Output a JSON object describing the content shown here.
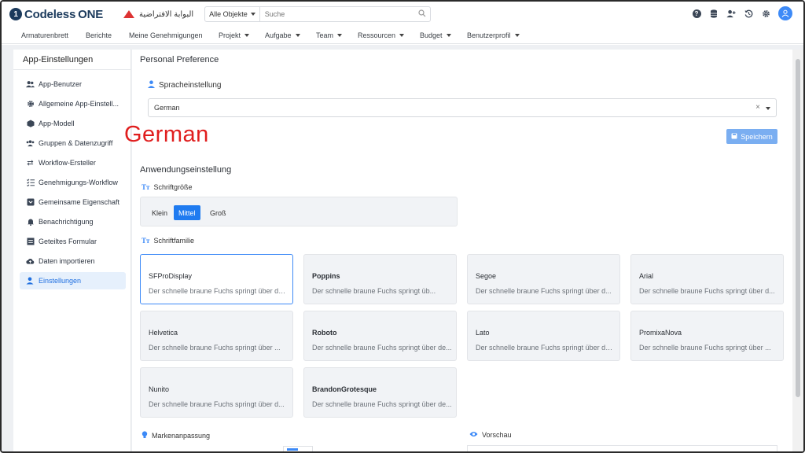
{
  "header": {
    "logo_text": "Codeless",
    "logo_one": "ONE",
    "arabic_portal": "البوابة الافتراضية",
    "search_scope": "Alle Objekte",
    "search_placeholder": "Suche"
  },
  "menu": [
    {
      "label": "Armaturenbrett",
      "has_caret": false
    },
    {
      "label": "Berichte",
      "has_caret": false
    },
    {
      "label": "Meine Genehmigungen",
      "has_caret": false
    },
    {
      "label": "Projekt",
      "has_caret": true
    },
    {
      "label": "Aufgabe",
      "has_caret": true
    },
    {
      "label": "Team",
      "has_caret": true
    },
    {
      "label": "Ressourcen",
      "has_caret": true
    },
    {
      "label": "Budget",
      "has_caret": true
    },
    {
      "label": "Benutzerprofil",
      "has_caret": true
    }
  ],
  "sidebar": {
    "title": "App-Einstellungen",
    "items": [
      {
        "label": "App-Benutzer",
        "icon": "users-icon"
      },
      {
        "label": "Allgemeine App-Einstell...",
        "icon": "gear-icon"
      },
      {
        "label": "App-Modell",
        "icon": "cube-icon"
      },
      {
        "label": "Gruppen & Datenzugriff",
        "icon": "group-icon"
      },
      {
        "label": "Workflow-Ersteller",
        "icon": "swap-icon"
      },
      {
        "label": "Genehmigungs-Workflow",
        "icon": "checklist-icon"
      },
      {
        "label": "Gemeinsame Eigenschaft",
        "icon": "card-icon"
      },
      {
        "label": "Benachrichtigung",
        "icon": "bell-icon"
      },
      {
        "label": "Geteiltes Formular",
        "icon": "form-icon"
      },
      {
        "label": "Daten importieren",
        "icon": "cloud-upload-icon"
      },
      {
        "label": "Einstellungen",
        "icon": "user-settings-icon",
        "active": true
      }
    ]
  },
  "main": {
    "section_title": "Personal Preference",
    "language_label": "Spracheinstellung",
    "language_value": "German",
    "clear_symbol": "×",
    "save_label": "Speichern",
    "annotation": "German",
    "app_settings_title": "Anwendungseinstellung",
    "font_size_label": "Schriftgröße",
    "font_sizes": [
      {
        "label": "Klein",
        "active": false
      },
      {
        "label": "Mittel",
        "active": true
      },
      {
        "label": "Groß",
        "active": false
      }
    ],
    "font_family_label": "Schriftfamilie",
    "font_families": [
      {
        "name": "SFProDisplay",
        "sample": "Der schnelle braune Fuchs springt über den f...",
        "selected": true
      },
      {
        "name": "Poppins",
        "sample": "Der schnelle braune Fuchs springt üb...",
        "selected": false
      },
      {
        "name": "Segoe",
        "sample": "Der schnelle braune Fuchs springt über d...",
        "selected": false
      },
      {
        "name": "Arial",
        "sample": "Der schnelle braune Fuchs springt über d...",
        "selected": false
      },
      {
        "name": "Helvetica",
        "sample": "Der schnelle braune Fuchs springt über ...",
        "selected": false
      },
      {
        "name": "Roboto",
        "sample": "Der schnelle braune Fuchs springt über de...",
        "selected": false
      },
      {
        "name": "Lato",
        "sample": "Der schnelle braune Fuchs springt über den...",
        "selected": false
      },
      {
        "name": "PromixaNova",
        "sample": "Der schnelle braune Fuchs springt über ...",
        "selected": false
      },
      {
        "name": "Nunito",
        "sample": "Der schnelle braune Fuchs springt über d...",
        "selected": false
      },
      {
        "name": "BrandonGrotesque",
        "sample": "Der schnelle braune Fuchs springt über de...",
        "selected": false
      }
    ],
    "brand_label": "Markenanpassung",
    "preview_label": "Vorschau"
  },
  "colors": {
    "accent": "#1f7bf0",
    "annotation": "#e01e1e",
    "save_button": "#7aaef1"
  }
}
